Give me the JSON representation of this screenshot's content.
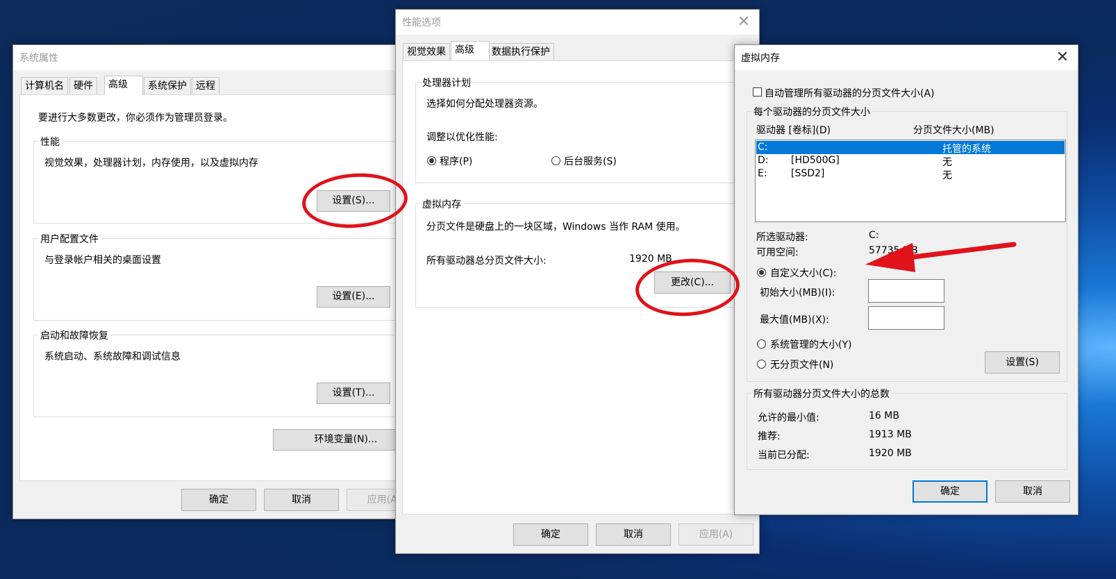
{
  "sys_props": {
    "title": "系统属性",
    "tabs": [
      "计算机名",
      "硬件",
      "高级",
      "系统保护",
      "远程"
    ],
    "notice": "要进行大多数更改，你必须作为管理员登录。",
    "perf": {
      "title": "性能",
      "desc": "视觉效果，处理器计划，内存使用，以及虚拟内存",
      "button": "设置(S)..."
    },
    "profile": {
      "title": "用户配置文件",
      "desc": "与登录帐户相关的桌面设置",
      "button": "设置(E)..."
    },
    "startup": {
      "title": "启动和故障恢复",
      "desc": "系统启动、系统故障和调试信息",
      "button": "设置(T)..."
    },
    "env_button": "环境变量(N)...",
    "ok": "确定",
    "cancel": "取消",
    "apply": "应用(A)"
  },
  "perf_options": {
    "title": "性能选项",
    "close": "✕",
    "tabs": [
      "视觉效果",
      "高级",
      "数据执行保护"
    ],
    "cpu": {
      "title": "处理器计划",
      "desc": "选择如何分配处理器资源。",
      "adjust": "调整以优化性能:",
      "opt1": "程序(P)",
      "opt2": "后台服务(S)"
    },
    "vm": {
      "title": "虚拟内存",
      "desc": "分页文件是硬盘上的一块区域，Windows 当作 RAM 使用。",
      "total_label": "所有驱动器总分页文件大小:",
      "total_value": "1920 MB",
      "button": "更改(C)..."
    },
    "ok": "确定",
    "cancel": "取消",
    "apply": "应用(A)"
  },
  "virtual_memory": {
    "title": "虚拟内存",
    "close": "✕",
    "auto_manage": "自动管理所有驱动器的分页文件大小(A)",
    "per_drive_title": "每个驱动器的分页文件大小",
    "col_drive": "驱动器 [卷标](D)",
    "col_size": "分页文件大小(MB)",
    "drives": [
      {
        "letter": "C:",
        "label": "",
        "size": "托管的系统"
      },
      {
        "letter": "D:",
        "label": "[HD500G]",
        "size": "无"
      },
      {
        "letter": "E:",
        "label": "[SSD2]",
        "size": "无"
      }
    ],
    "selected_drive_label": "所选驱动器:",
    "selected_drive_value": "C:",
    "free_space_label": "可用空间:",
    "free_space_value": "57735 MB",
    "custom_size": "自定义大小(C):",
    "initial_size": "初始大小(MB)(I):",
    "max_size": "最大值(MB)(X):",
    "system_managed": "系统管理的大小(Y)",
    "no_paging": "无分页文件(N)",
    "set_button": "设置(S)",
    "totals_title": "所有驱动器分页文件大小的总数",
    "min_label": "允许的最小值:",
    "min_value": "16 MB",
    "rec_label": "推荐:",
    "rec_value": "1913 MB",
    "cur_label": "当前已分配:",
    "cur_value": "1920 MB",
    "ok": "确定",
    "cancel": "取消"
  }
}
